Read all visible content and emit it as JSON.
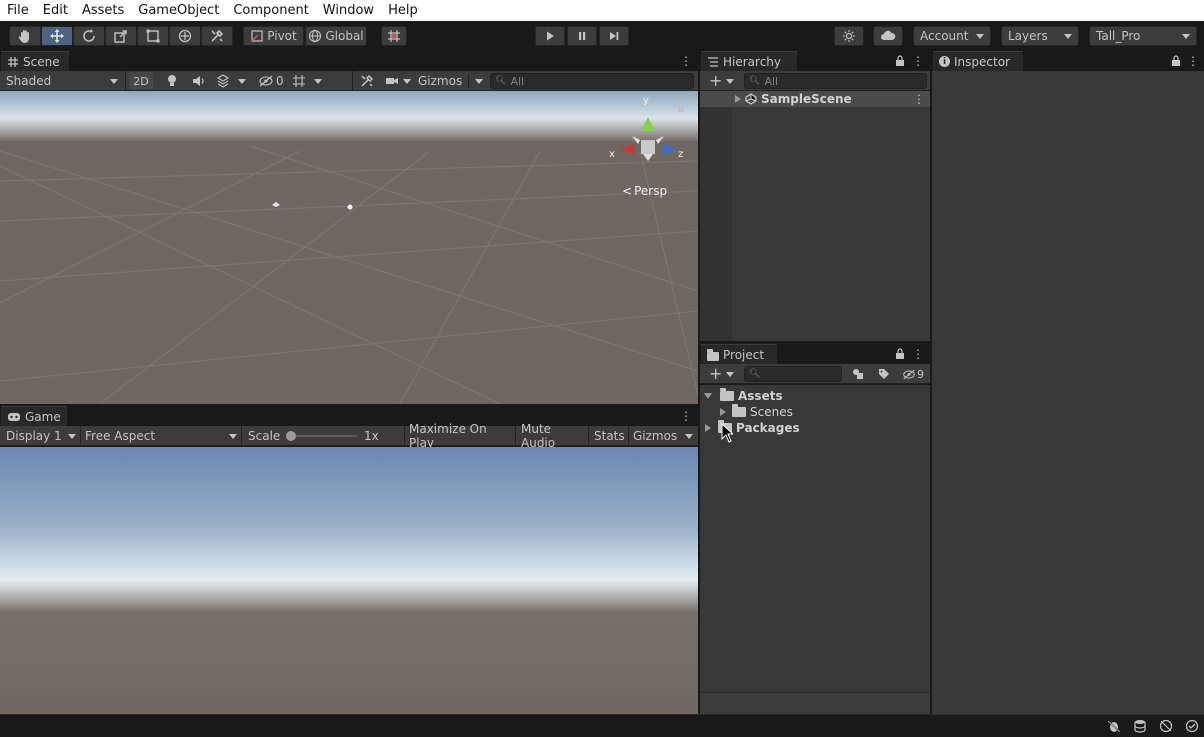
{
  "menu": [
    "File",
    "Edit",
    "Assets",
    "GameObject",
    "Component",
    "Window",
    "Help"
  ],
  "toolbar": {
    "pivot_label": "Pivot",
    "global_label": "Global",
    "account_label": "Account",
    "layers_label": "Layers",
    "layout_label": "Tall_Pro"
  },
  "scene": {
    "tab_label": "Scene",
    "shading_label": "Shaded",
    "mode_2d_label": "2D",
    "hidden_count": "0",
    "gizmos_label": "Gizmos",
    "search_placeholder": "All",
    "persp_label": "Persp",
    "axis_x": "x",
    "axis_y": "y",
    "axis_z": "z"
  },
  "game": {
    "tab_label": "Game",
    "display_label": "Display 1",
    "aspect_label": "Free Aspect",
    "scale_label": "Scale",
    "scale_value": "1x",
    "maximize_label": "Maximize On Play",
    "mute_label": "Mute Audio",
    "stats_label": "Stats",
    "gizmos_label": "Gizmos"
  },
  "hierarchy": {
    "tab_label": "Hierarchy",
    "search_placeholder": "All",
    "items": [
      "SampleScene"
    ]
  },
  "project": {
    "tab_label": "Project",
    "hidden_count": "9",
    "tree": [
      {
        "label": "Assets",
        "bold": true
      },
      {
        "label": "Scenes",
        "bold": false
      },
      {
        "label": "Packages",
        "bold": true
      }
    ]
  },
  "inspector": {
    "tab_label": "Inspector"
  },
  "colors": {
    "active_tool": "#4a6481",
    "panel_bg": "#383838",
    "toolbar_bg": "#191919",
    "menu_bg": "#ffffff"
  }
}
